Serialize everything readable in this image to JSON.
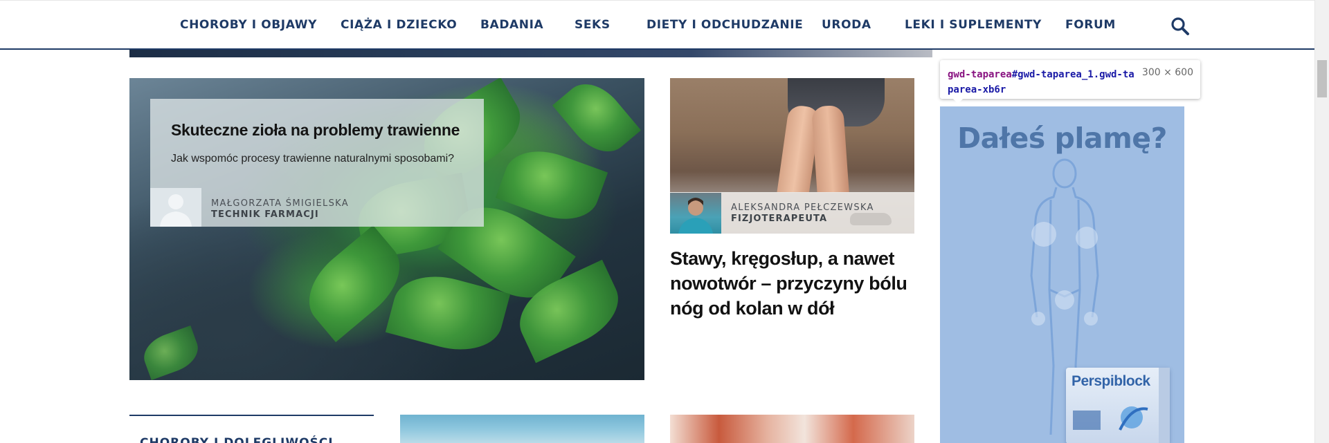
{
  "nav": {
    "items": [
      {
        "label": "CHOROBY I OBJAWY"
      },
      {
        "label": "CIĄŻA I DZIECKO"
      },
      {
        "label": "BADANIA"
      },
      {
        "label": "SEKS"
      },
      {
        "label": "DIETY I ODCHUDZANIE"
      },
      {
        "label": "URODA"
      },
      {
        "label": "LEKI I SUPLEMENTY"
      },
      {
        "label": "FORUM"
      }
    ],
    "search_icon": "search-icon"
  },
  "feature": {
    "title": "Skuteczne zioła na problemy trawienne",
    "description": "Jak wspomóc procesy trawienne naturalnymi sposobami?",
    "author_name": "MAŁGORZATA ŚMIGIELSKA",
    "author_role": "TECHNIK FARMACJI",
    "avatar_icon": "user-placeholder-icon"
  },
  "card2": {
    "author_name": "ALEKSANDRA PEŁCZEWSKA",
    "author_role": "FIZJOTERAPEUTA",
    "title": "Stawy, kręgosłup, a nawet nowotwór – przyczyny bólu nóg od kolan w dół"
  },
  "section": {
    "title": "CHOROBY I DOLEGLIWOŚCI"
  },
  "ad": {
    "headline": "Dałeś plamę?",
    "brand": "Perspiblock"
  },
  "tooltip": {
    "tag": "gwd-taparea",
    "selector": "#gwd-taparea_1.gwd-taparea-xb6r",
    "dimensions": "300 × 600"
  },
  "colors": {
    "nav_text": "#1e3a66",
    "ad_bg": "#9fbde3",
    "ad_text": "#4f76a8"
  }
}
